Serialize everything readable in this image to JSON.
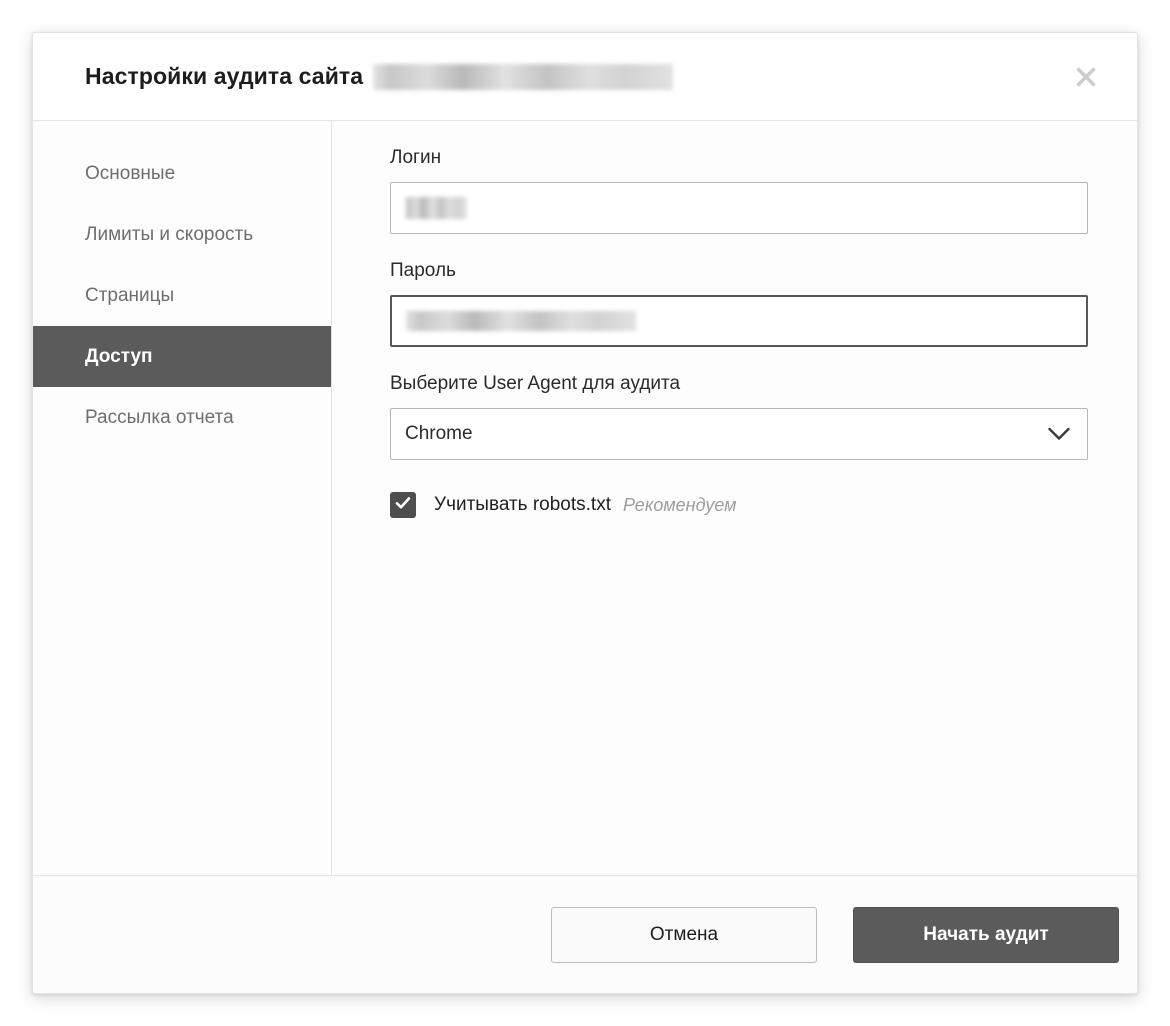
{
  "dialog": {
    "title": "Настройки аудита сайта",
    "title_redacted_placeholder": "",
    "close_icon": "close-icon"
  },
  "sidebar": {
    "items": [
      {
        "label": "Основные",
        "active": false
      },
      {
        "label": "Лимиты и скорость",
        "active": false
      },
      {
        "label": "Страницы",
        "active": false
      },
      {
        "label": "Доступ",
        "active": true
      },
      {
        "label": "Рассылка отчета",
        "active": false
      }
    ]
  },
  "content": {
    "login": {
      "label": "Логин",
      "value": "",
      "placeholder": ""
    },
    "password": {
      "label": "Пароль",
      "value": "",
      "placeholder": "",
      "focused": true
    },
    "user_agent": {
      "label": "Выберите User Agent для аудита",
      "selected": "Chrome",
      "arrow_icon": "chevron-down-icon"
    },
    "robots": {
      "checked": true,
      "label": "Учитывать robots.txt",
      "hint": "Рекомендуем",
      "check_icon": "check-icon"
    }
  },
  "footer": {
    "cancel_label": "Отмена",
    "submit_label": "Начать аудит"
  },
  "colors": {
    "accent_dark": "#5b5b5b",
    "text_primary": "#1d1d1d",
    "text_muted": "#6e6e6e",
    "border": "#b7b7b7",
    "hint": "#9d9d9d"
  }
}
